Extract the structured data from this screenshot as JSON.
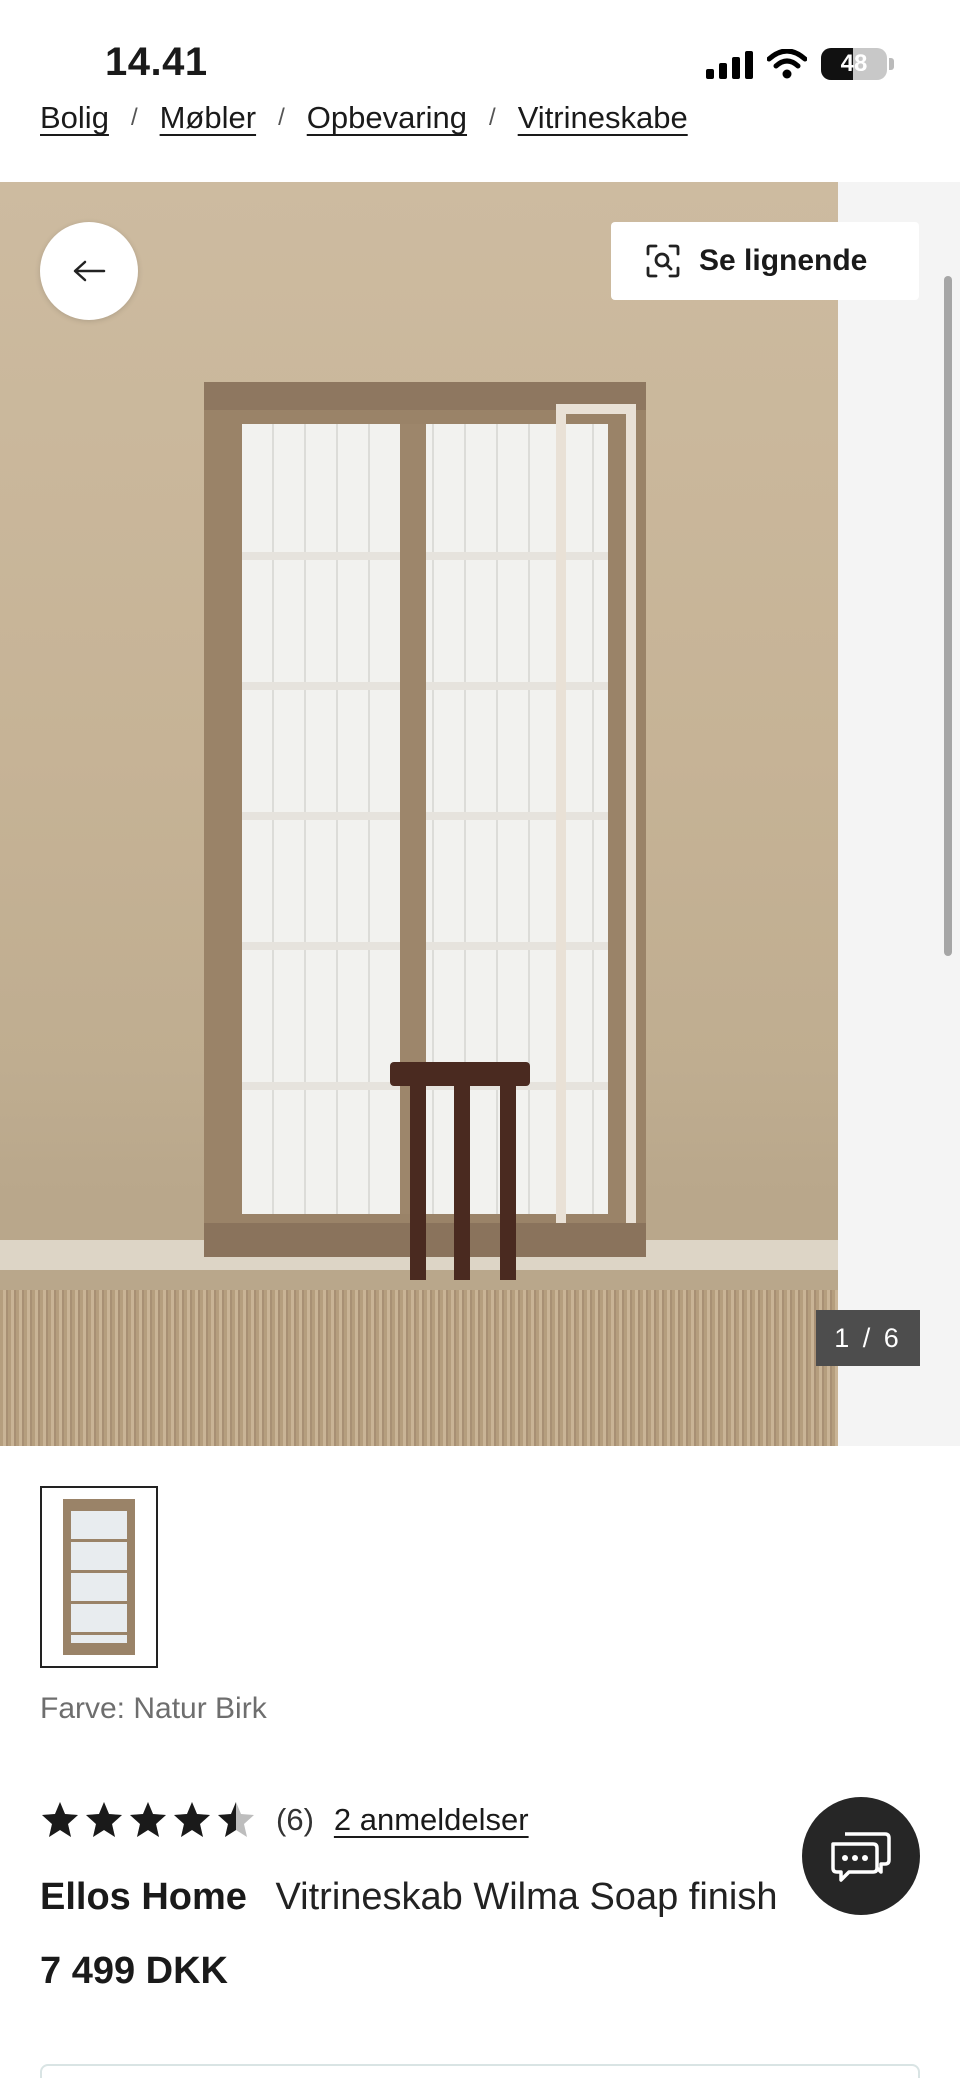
{
  "status_bar": {
    "time": "14.41",
    "battery": "48",
    "battery_level_percent": 48,
    "icons": [
      "signal-icon",
      "wifi-icon",
      "battery-icon"
    ]
  },
  "breadcrumb": [
    {
      "label": "Bolig"
    },
    {
      "label": "Møbler"
    },
    {
      "label": "Opbevaring"
    },
    {
      "label": "Vitrineskabe"
    }
  ],
  "breadcrumb_separator": "/",
  "gallery": {
    "similar_label": "Se lignende",
    "counter": "1 / 6",
    "back_icon": "arrow-left-icon",
    "similar_icon": "visual-search-icon"
  },
  "product": {
    "color_text": "Farve: Natur Birk",
    "rating_value": 4.5,
    "rating_max": 5,
    "review_count": "(6)",
    "reviews_link": "2 anmeldelser",
    "brand": "Ellos Home",
    "name": "Vitrineskab Wilma Soap finish",
    "price": "7 499 DKK"
  },
  "chat": {
    "icon": "chat-icon"
  },
  "colors": {
    "accent": "#262626",
    "counter_bg": "#4d4d4d",
    "wall": "#c6b396"
  }
}
